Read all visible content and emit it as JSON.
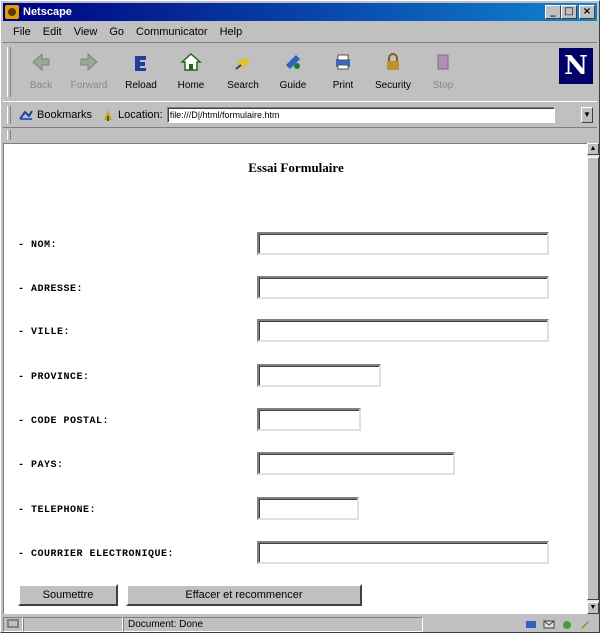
{
  "window": {
    "title": "Netscape"
  },
  "menu": {
    "items": [
      {
        "label": "File"
      },
      {
        "label": "Edit"
      },
      {
        "label": "View"
      },
      {
        "label": "Go"
      },
      {
        "label": "Communicator"
      },
      {
        "label": "Help"
      }
    ]
  },
  "toolbar": {
    "buttons": [
      {
        "label": "Back",
        "icon": "back-arrow-icon",
        "enabled": false
      },
      {
        "label": "Forward",
        "icon": "forward-arrow-icon",
        "enabled": false
      },
      {
        "label": "Reload",
        "icon": "reload-icon",
        "enabled": true
      },
      {
        "label": "Home",
        "icon": "home-icon",
        "enabled": true
      },
      {
        "label": "Search",
        "icon": "search-icon",
        "enabled": true
      },
      {
        "label": "Guide",
        "icon": "guide-icon",
        "enabled": true
      },
      {
        "label": "Print",
        "icon": "printer-icon",
        "enabled": true
      },
      {
        "label": "Security",
        "icon": "lock-icon",
        "enabled": true
      },
      {
        "label": "Stop",
        "icon": "stop-icon",
        "enabled": false
      }
    ],
    "logo": "N"
  },
  "location_bar": {
    "bookmarks_label": "Bookmarks",
    "location_label": "Location:",
    "url": "file:///D|/html/formulaire.htm"
  },
  "page": {
    "title": "Essai Formulaire",
    "fields": [
      {
        "label": "- NOM:",
        "value": ""
      },
      {
        "label": "- ADRESSE:",
        "value": ""
      },
      {
        "label": "- VILLE:",
        "value": ""
      },
      {
        "label": "- PROVINCE:",
        "value": ""
      },
      {
        "label": "- CODE POSTAL:",
        "value": ""
      },
      {
        "label": "- PAYS:",
        "value": ""
      },
      {
        "label": "- TELEPHONE:",
        "value": ""
      },
      {
        "label": "- COURRIER ELECTRONIQUE:",
        "value": ""
      }
    ],
    "submit_label": "Soumettre",
    "reset_label": "Effacer et recommencer"
  },
  "status": {
    "text": "Document: Done"
  },
  "colors": {
    "titlebar": "#000080",
    "window": "#c0c0c0",
    "content": "#ffffff"
  }
}
